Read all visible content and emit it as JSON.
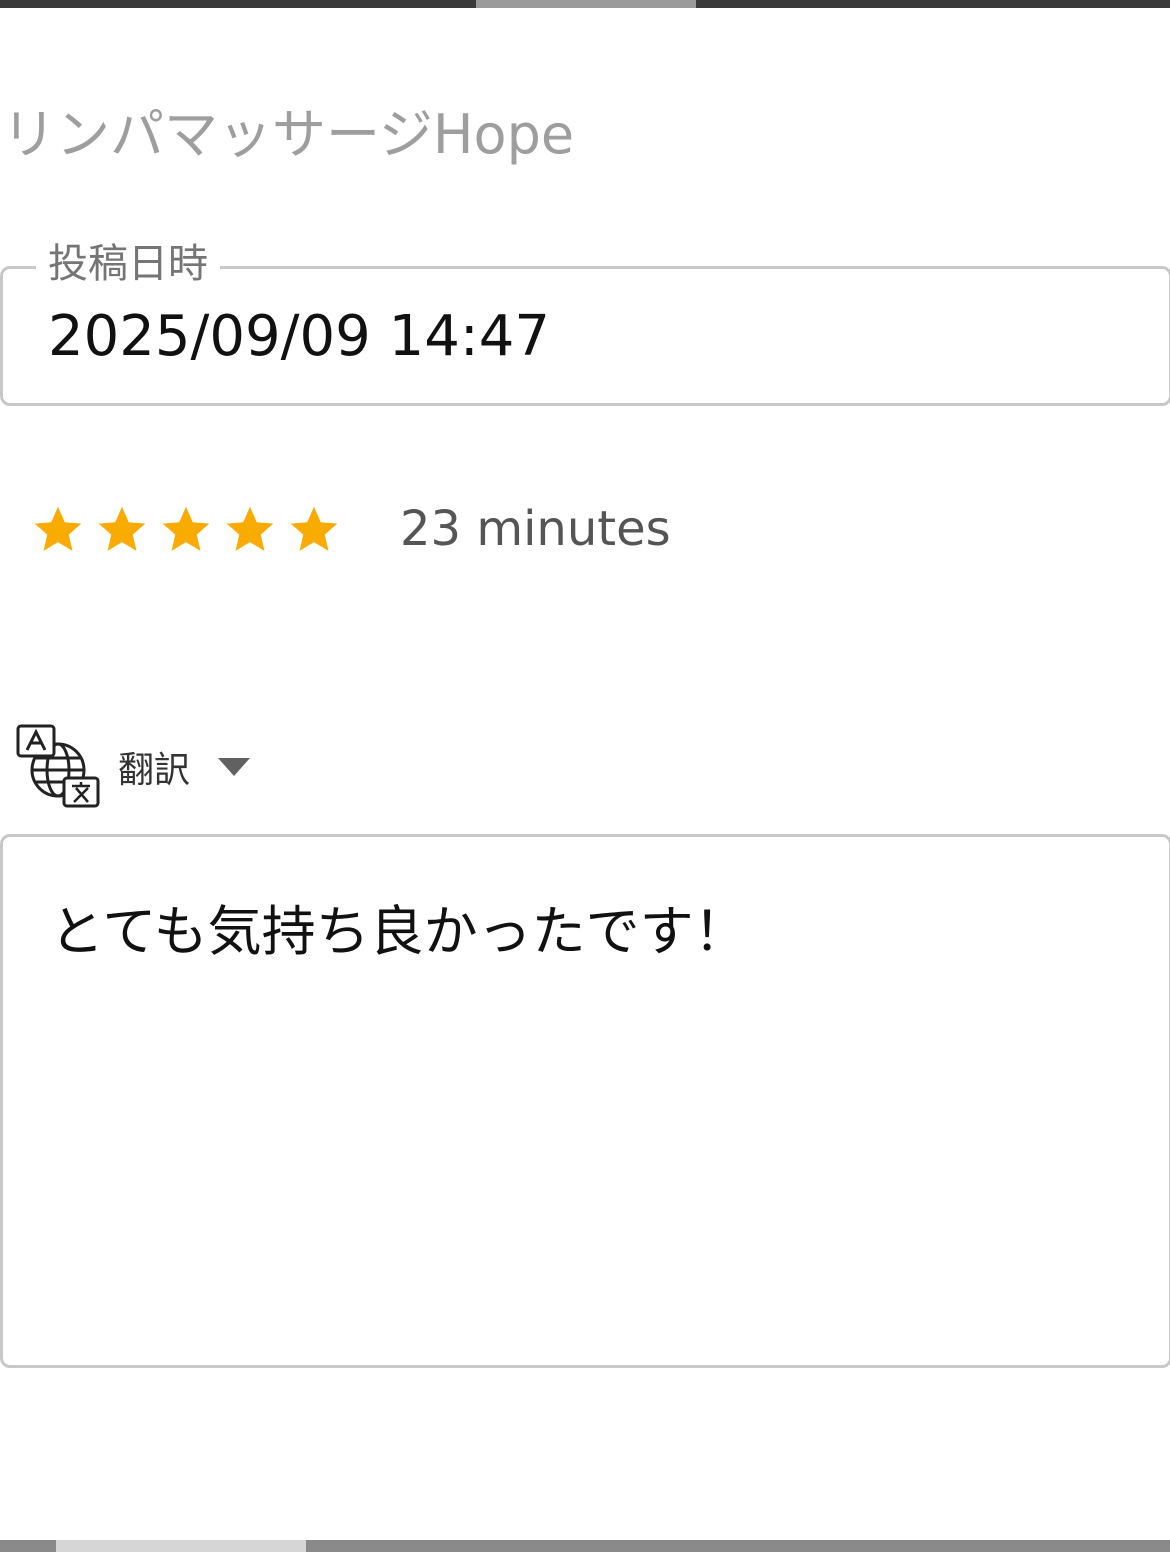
{
  "shop": {
    "name": "リンパマッサージHope"
  },
  "post_date": {
    "label": "投稿日時",
    "value": "2025/09/09 14:47"
  },
  "rating": {
    "stars": 5,
    "max_stars": 5,
    "star_color": "#F9AB00",
    "duration": "23 minutes"
  },
  "translate": {
    "icon": "translate-icon",
    "label": "翻訳",
    "arrow_icon": "dropdown-arrow-icon"
  },
  "comment": {
    "text": "とても気持ち良かったです！"
  }
}
